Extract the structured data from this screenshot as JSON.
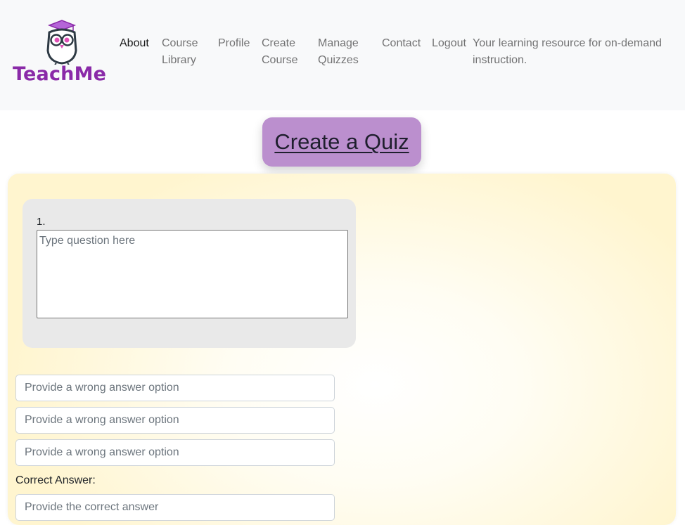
{
  "brand": {
    "name": "TeachMe",
    "accent": "#8a2aa8"
  },
  "nav": {
    "items": [
      {
        "label": "About",
        "active": true
      },
      {
        "label": "Course Library"
      },
      {
        "label": "Profile"
      },
      {
        "label": "Create Course"
      },
      {
        "label": "Manage Quizzes"
      },
      {
        "label": "Contact"
      },
      {
        "label": "Logout"
      }
    ],
    "tagline": "Your learning resource for on-demand instruction."
  },
  "page": {
    "title": "Create a Quiz",
    "title_bg": "#bb8fce"
  },
  "quiz": {
    "question_number": "1.",
    "question_placeholder": "Type question here",
    "wrong_placeholder": "Provide a wrong answer option",
    "correct_label": "Correct Answer:",
    "correct_placeholder": "Provide the correct answer"
  }
}
